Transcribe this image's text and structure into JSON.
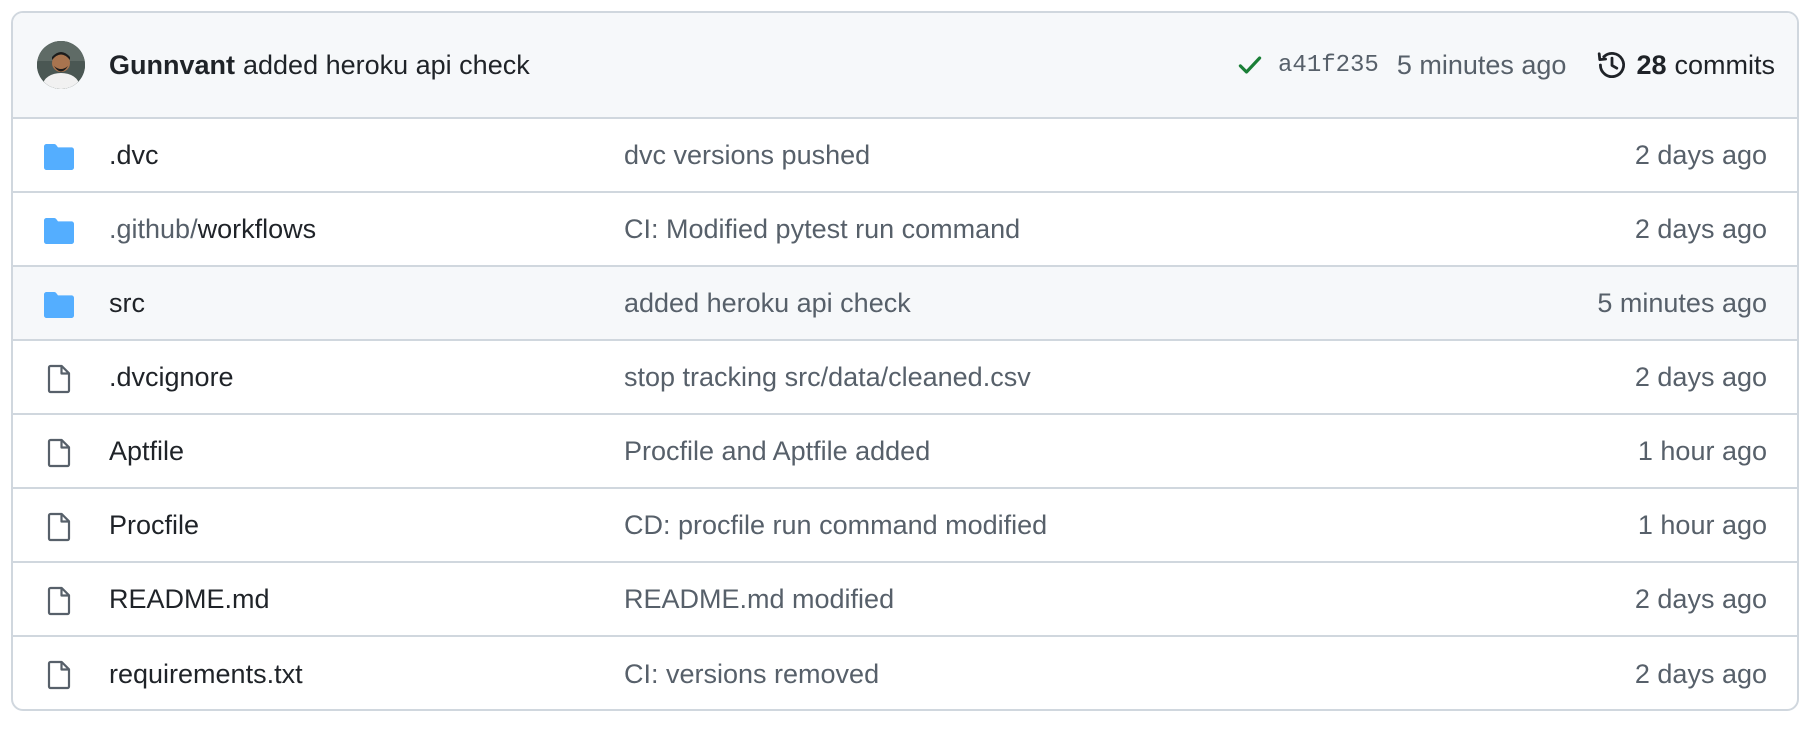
{
  "latest_commit": {
    "author": "Gunnvant",
    "message": "added heroku api check",
    "sha": "a41f235",
    "time": "5 minutes ago",
    "commit_count": "28",
    "commit_word": "commits",
    "status": "success"
  },
  "colors": {
    "folder": "#54aeff",
    "success": "#1a7f37",
    "border": "#d0d7de",
    "muted": "#57606a"
  },
  "files": [
    {
      "type": "folder",
      "prefix": "",
      "name": ".dvc",
      "message": "dvc versions pushed",
      "time": "2 days ago"
    },
    {
      "type": "folder",
      "prefix": ".github/",
      "name": "workflows",
      "message": "CI: Modified pytest run command",
      "time": "2 days ago"
    },
    {
      "type": "folder",
      "prefix": "",
      "name": "src",
      "message": "added heroku api check",
      "time": "5 minutes ago",
      "hover": true
    },
    {
      "type": "file",
      "prefix": "",
      "name": ".dvcignore",
      "message": "stop tracking src/data/cleaned.csv",
      "time": "2 days ago"
    },
    {
      "type": "file",
      "prefix": "",
      "name": "Aptfile",
      "message": "Procfile and Aptfile added",
      "time": "1 hour ago"
    },
    {
      "type": "file",
      "prefix": "",
      "name": "Procfile",
      "message": "CD: procfile run command modified",
      "time": "1 hour ago"
    },
    {
      "type": "file",
      "prefix": "",
      "name": "README.md",
      "message": "README.md modified",
      "time": "2 days ago"
    },
    {
      "type": "file",
      "prefix": "",
      "name": "requirements.txt",
      "message": "CI: versions removed",
      "time": "2 days ago"
    }
  ]
}
